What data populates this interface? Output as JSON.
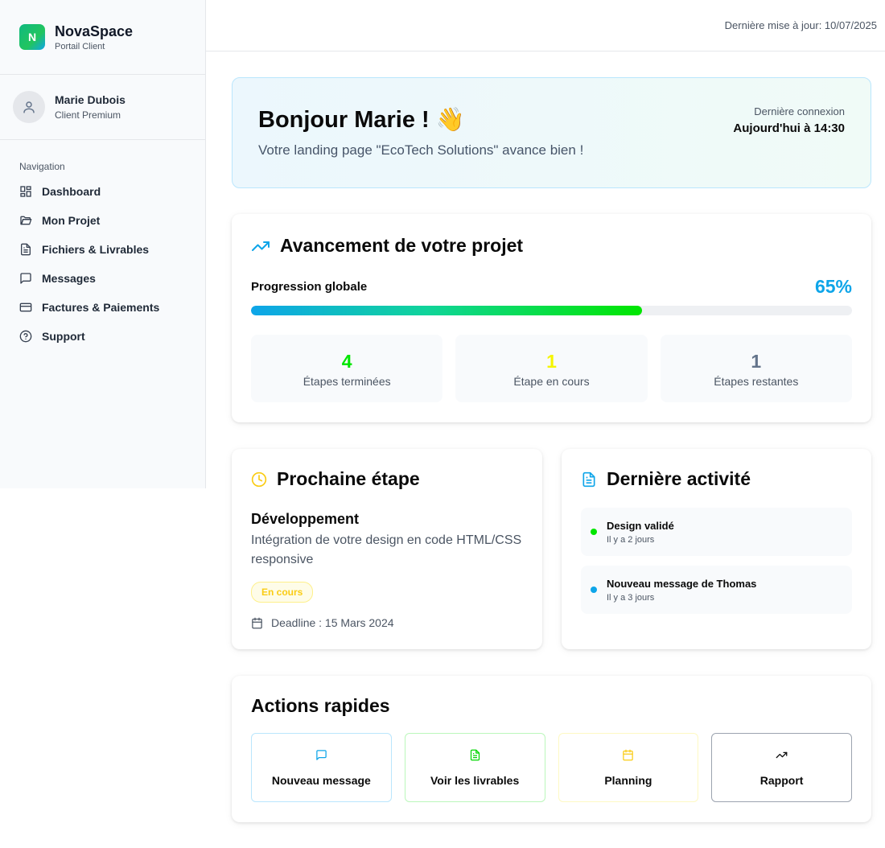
{
  "brand": {
    "logo_letter": "N",
    "name": "NovaSpace",
    "subtitle": "Portail Client"
  },
  "user": {
    "name": "Marie Dubois",
    "tier": "Client Premium"
  },
  "nav": {
    "title": "Navigation",
    "items": [
      {
        "label": "Dashboard",
        "icon": "dashboard-icon"
      },
      {
        "label": "Mon Projet",
        "icon": "folder-icon"
      },
      {
        "label": "Fichiers & Livrables",
        "icon": "file-icon"
      },
      {
        "label": "Messages",
        "icon": "message-icon"
      },
      {
        "label": "Factures & Paiements",
        "icon": "credit-card-icon"
      },
      {
        "label": "Support",
        "icon": "help-icon"
      }
    ]
  },
  "topbar": {
    "last_update": "Dernière mise à jour: 10/07/2025"
  },
  "welcome": {
    "greeting": "Bonjour Marie ! 👋",
    "message": "Votre landing page \"EcoTech Solutions\" avance bien !",
    "last_login_label": "Dernière connexion",
    "last_login_value": "Aujourd'hui à 14:30"
  },
  "progress": {
    "title": "Avancement de votre projet",
    "label": "Progression globale",
    "value_text": "65%",
    "value": 0.65,
    "stats": [
      {
        "number": "4",
        "label": "Étapes terminées",
        "color": "#00e600"
      },
      {
        "number": "1",
        "label": "Étape en cours",
        "color": "#f5f500"
      },
      {
        "number": "1",
        "label": "Étapes restantes",
        "color": "#64748b"
      }
    ]
  },
  "next_step": {
    "title": "Prochaine étape",
    "name": "Développement",
    "description": "Intégration de votre design en code HTML/CSS responsive",
    "badge": "En cours",
    "deadline": "Deadline : 15 Mars 2024"
  },
  "activity": {
    "title": "Dernière activité",
    "items": [
      {
        "title": "Design validé",
        "time": "Il y a 2 jours",
        "color": "#00e600"
      },
      {
        "title": "Nouveau message de Thomas",
        "time": "Il y a 3 jours",
        "color": "#0ea5e9"
      }
    ]
  },
  "quick_actions": {
    "title": "Actions rapides",
    "items": [
      {
        "label": "Nouveau message",
        "icon": "message-icon",
        "color": "#0ea5e9"
      },
      {
        "label": "Voir les livrables",
        "icon": "file-icon",
        "color": "#00e600"
      },
      {
        "label": "Planning",
        "icon": "calendar-icon",
        "color": "#facc15"
      },
      {
        "label": "Rapport",
        "icon": "trend-icon",
        "color": "#0a0a0a"
      }
    ]
  },
  "colors": {
    "accent_blue": "#0ea5e9",
    "accent_green": "#00e600",
    "accent_yellow": "#facc15"
  }
}
